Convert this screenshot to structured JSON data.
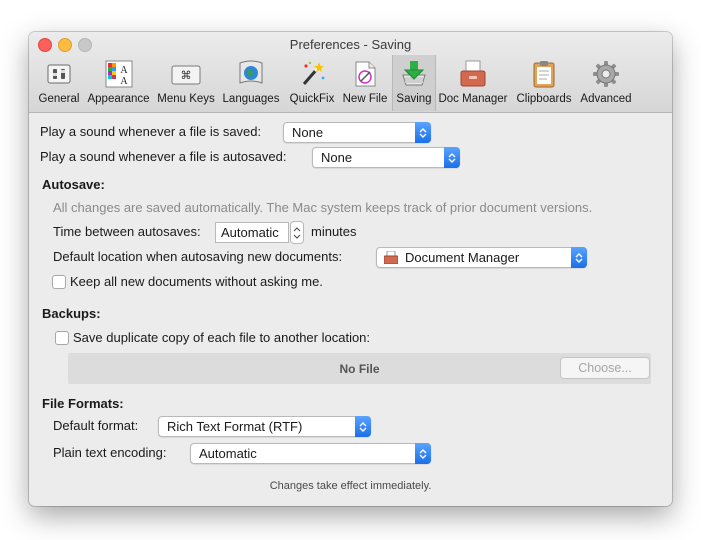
{
  "window": {
    "title": "Preferences - Saving"
  },
  "toolbar": {
    "items": [
      {
        "label": "General",
        "icon": "general-switches-icon"
      },
      {
        "label": "Appearance",
        "icon": "appearance-palette-icon"
      },
      {
        "label": "Menu Keys",
        "icon": "command-key-icon"
      },
      {
        "label": "Languages",
        "icon": "globe-flag-icon"
      },
      {
        "label": "QuickFix",
        "icon": "magic-wand-icon"
      },
      {
        "label": "New File",
        "icon": "new-file-icon"
      },
      {
        "label": "Saving",
        "icon": "save-tray-icon",
        "selected": true
      },
      {
        "label": "Doc Manager",
        "icon": "doc-manager-icon"
      },
      {
        "label": "Clipboards",
        "icon": "clipboard-icon"
      },
      {
        "label": "Advanced",
        "icon": "gear-icon"
      }
    ]
  },
  "sound": {
    "saved_label": "Play a sound whenever a file is saved:",
    "saved_value": "None",
    "autosaved_label": "Play a sound whenever a file is autosaved:",
    "autosaved_value": "None"
  },
  "autosave": {
    "header": "Autosave:",
    "note": "All changes are saved automatically. The Mac system keeps track of prior document versions.",
    "time_label": "Time between autosaves:",
    "time_value": "Automatic",
    "time_unit": "minutes",
    "location_label": "Default location when autosaving new documents:",
    "location_value": "Document Manager",
    "keep_label": "Keep all new documents without asking me."
  },
  "backups": {
    "header": "Backups:",
    "duplicate_label": "Save duplicate copy of each file to another location:",
    "location_value": "No File",
    "choose_label": "Choose..."
  },
  "formats": {
    "header": "File Formats:",
    "default_label": "Default format:",
    "default_value": "Rich Text Format (RTF)",
    "encoding_label": "Plain text encoding:",
    "encoding_value": "Automatic"
  },
  "footer": {
    "text": "Changes take effect immediately."
  },
  "colors": {
    "accent": "#1a6fe8",
    "window_bg": "#ececec"
  }
}
